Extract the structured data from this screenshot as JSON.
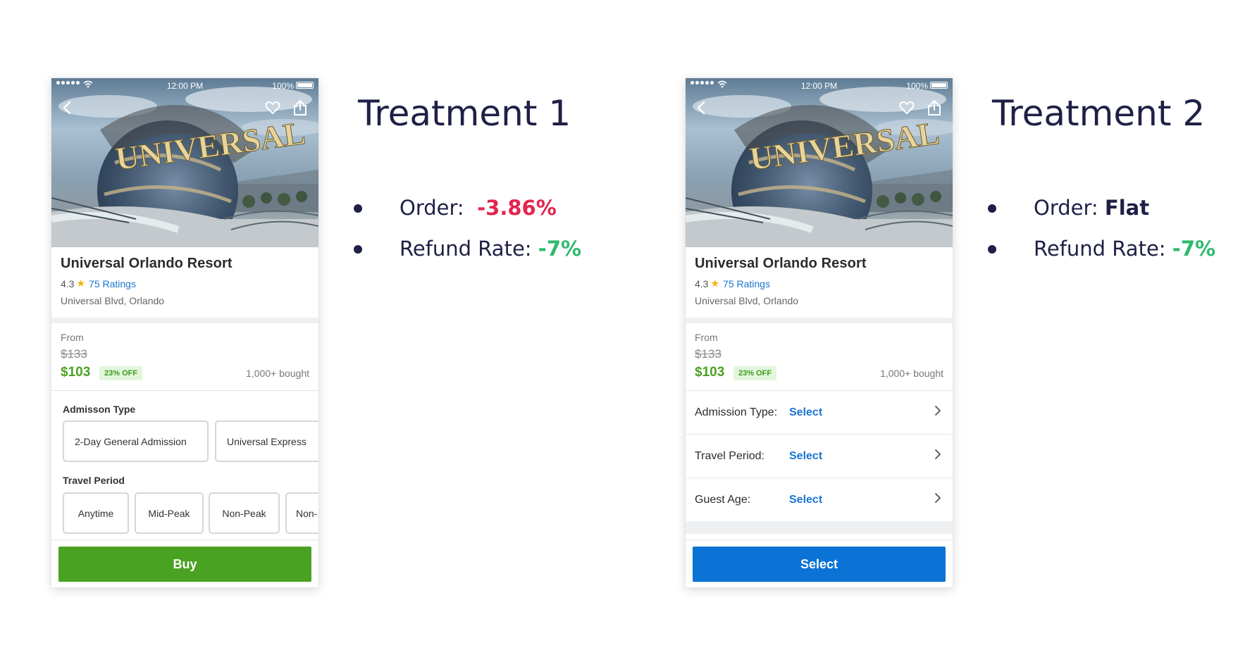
{
  "colors": {
    "heading": "#1f2046",
    "negative": "#e3254e",
    "positive": "#2fb96e",
    "buy_button": "#4aa223",
    "select_button": "#0a73d5",
    "link": "#1a76d2"
  },
  "phone1": {
    "status": {
      "time": "12:00 PM",
      "battery": "100%"
    },
    "hero_icons": [
      "back-icon",
      "heart-icon",
      "share-icon"
    ],
    "hero_sign": "UNIVERSAL",
    "title": "Universal Orlando Resort",
    "rating": "4.3",
    "ratings_count": "75 Ratings",
    "address": "Universal Blvd, Orlando",
    "from_label": "From",
    "old_price": "$133",
    "new_price": "$103",
    "discount": "23% OFF",
    "bought": "1,000+ bought",
    "admission_label": "Admisson Type",
    "admission_options": [
      "2-Day General Admission",
      "Universal Express"
    ],
    "travel_label": "Travel Period",
    "travel_options": [
      "Anytime",
      "Mid-Peak",
      "Non-Peak",
      "Non-"
    ],
    "cta": "Buy"
  },
  "phone2": {
    "status": {
      "time": "12:00 PM",
      "battery": "100%"
    },
    "hero_icons": [
      "back-icon",
      "heart-icon",
      "share-icon"
    ],
    "hero_sign": "UNIVERSAL",
    "title": "Universal Orlando Resort",
    "rating": "4.3",
    "ratings_count": "75 Ratings",
    "address": "Universal Blvd, Orlando",
    "from_label": "From",
    "old_price": "$133",
    "new_price": "$103",
    "discount": "23% OFF",
    "bought": "1,000+ bought",
    "rows": [
      {
        "label": "Admission Type:",
        "value": "Select"
      },
      {
        "label": "Travel Period:",
        "value": "Select"
      },
      {
        "label": "Guest Age:",
        "value": "Select"
      }
    ],
    "cta": "Select"
  },
  "treatment1": {
    "heading": "Treatment 1",
    "order_label": "Order:",
    "order_value": "-3.86%",
    "refund_label": "Refund Rate:",
    "refund_value": "-7%"
  },
  "treatment2": {
    "heading": "Treatment 2",
    "order_label": "Order:",
    "order_value": "Flat",
    "refund_label": "Refund Rate:",
    "refund_value": "-7%"
  }
}
